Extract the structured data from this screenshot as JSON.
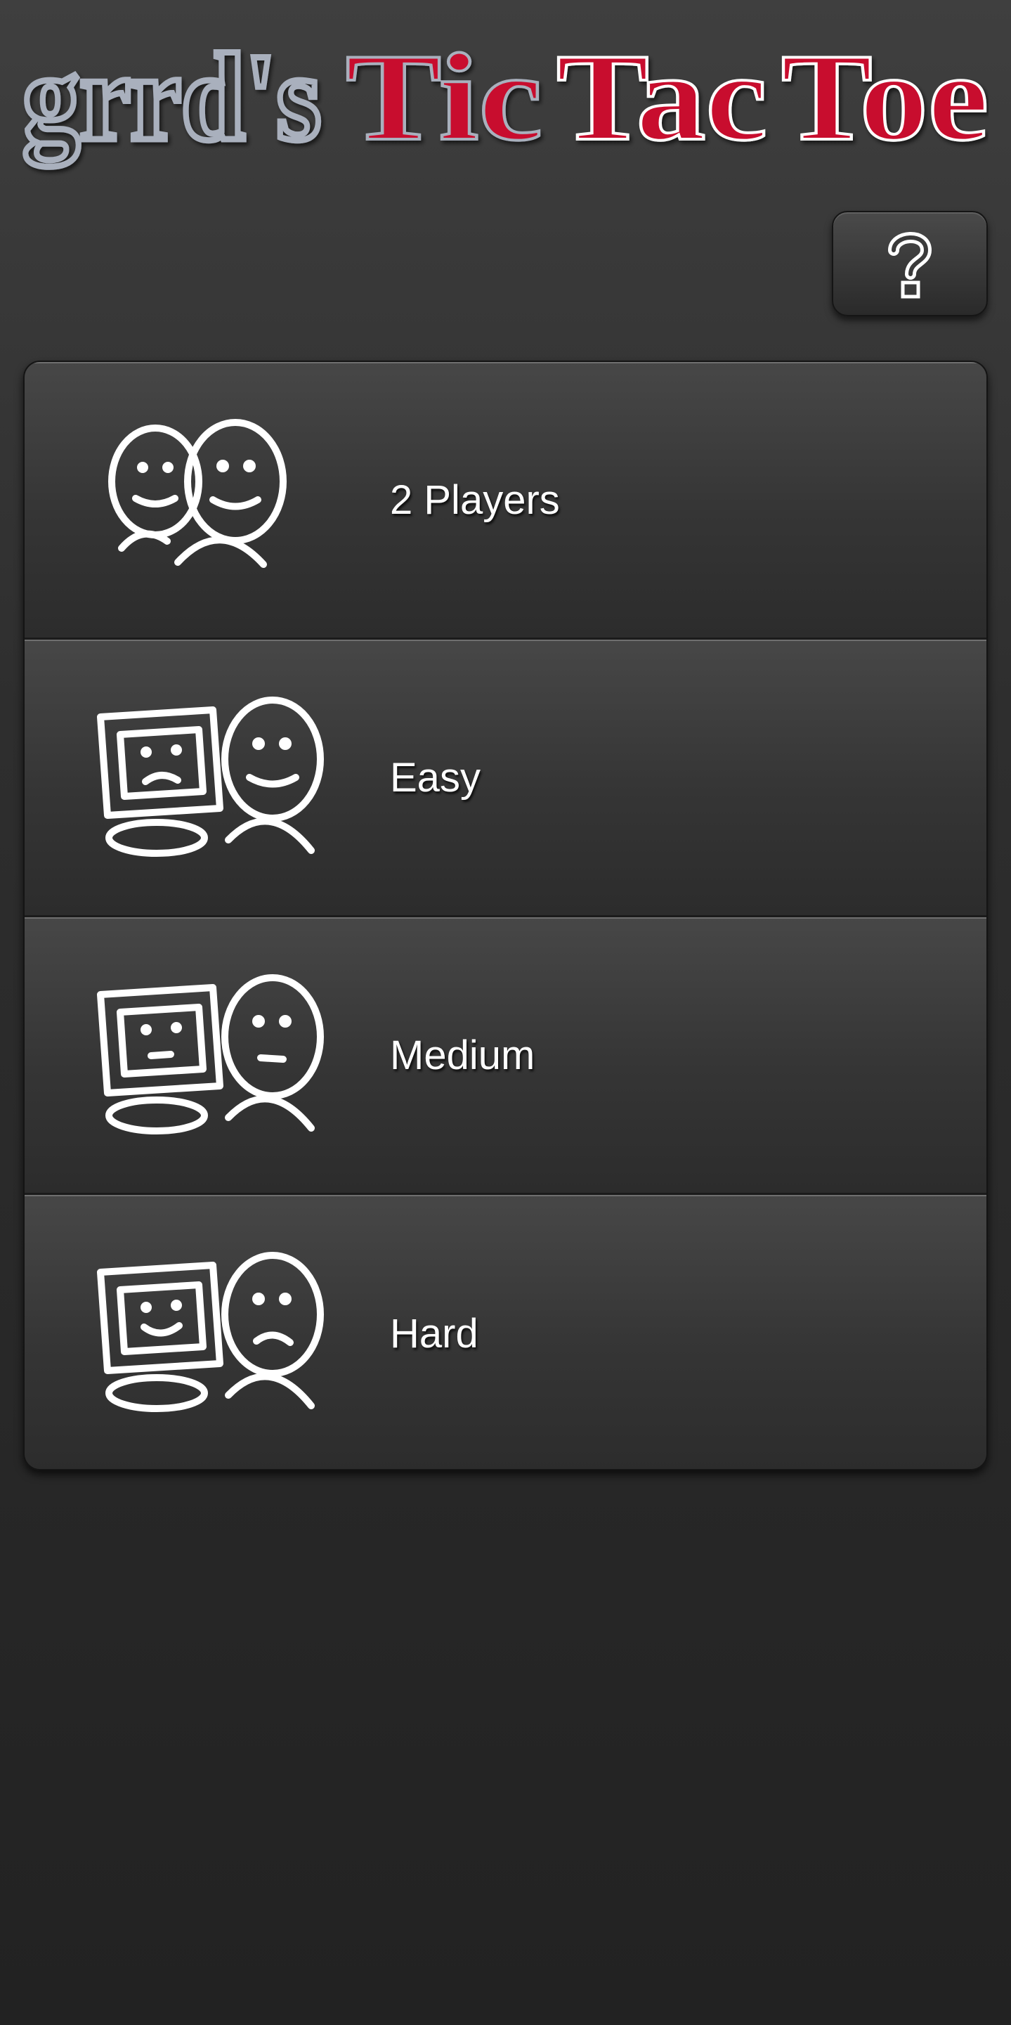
{
  "title": {
    "prefix": "grrd's",
    "word1": "Tic",
    "word2": "Tac",
    "word3": "Toe"
  },
  "colors": {
    "accent_red": "#c8102e",
    "title_gray": "#a9b0bd",
    "text_white": "#ffffff"
  },
  "help_button": {
    "icon": "question-mark-icon"
  },
  "menu": {
    "items": [
      {
        "label": "2 Players",
        "icon": "two-players-icon"
      },
      {
        "label": "Easy",
        "icon": "computer-happy-player-icon"
      },
      {
        "label": "Medium",
        "icon": "computer-neutral-player-icon"
      },
      {
        "label": "Hard",
        "icon": "computer-sad-player-icon"
      }
    ]
  }
}
